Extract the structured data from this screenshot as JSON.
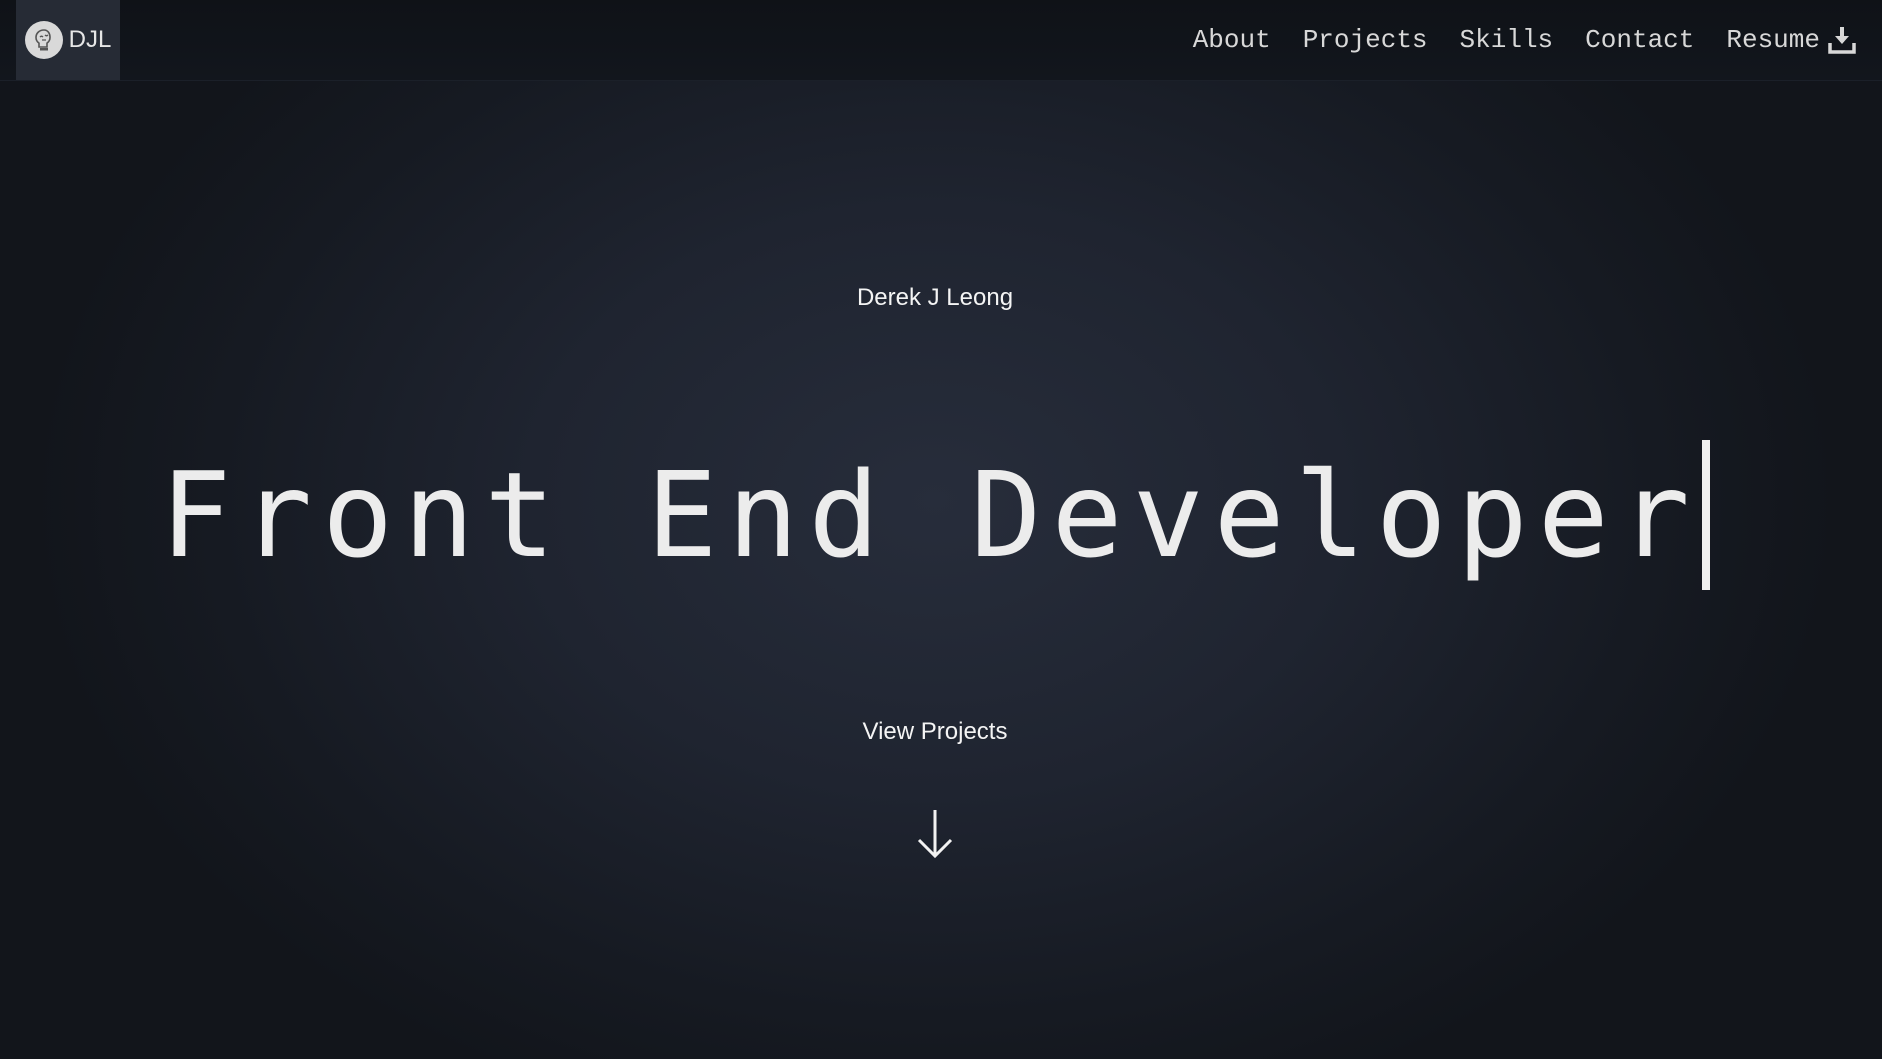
{
  "brand": {
    "text": "DJL",
    "logo_icon": "brain-lightbulb-icon"
  },
  "nav": {
    "items": [
      {
        "label": "About"
      },
      {
        "label": "Projects"
      },
      {
        "label": "Skills"
      },
      {
        "label": "Contact"
      },
      {
        "label": "Resume",
        "icon": "download-icon"
      }
    ]
  },
  "hero": {
    "name": "Derek J Leong",
    "headline": "Front End Developer",
    "cta_label": "View Projects",
    "arrow_icon": "arrow-down-icon"
  },
  "colors": {
    "background": "#1f2430",
    "navbar": "#0f1217",
    "brand_box": "#262b35",
    "text": "#f2f2f2"
  }
}
